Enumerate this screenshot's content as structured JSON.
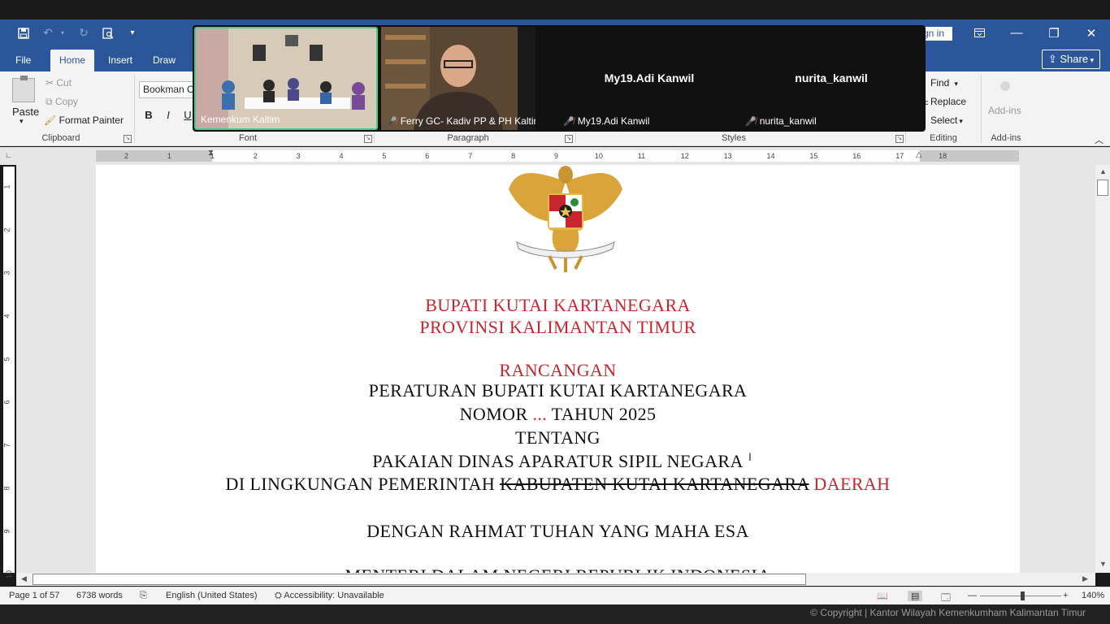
{
  "titlebar": {
    "sign_in": "gn in"
  },
  "tabs": [
    "File",
    "Home",
    "Insert",
    "Draw"
  ],
  "share_label": "Share",
  "ribbon": {
    "paste": "Paste",
    "cut": "Cut",
    "copy": "Copy",
    "format_painter": "Format Painter",
    "font_name": "Bookman O",
    "bold": "B",
    "italic": "I",
    "underline": "U",
    "find": "Find",
    "replace": "Replace",
    "select": "Select",
    "addins": "Add-ins",
    "groups": {
      "clipboard": "Clipboard",
      "font": "Font",
      "paragraph": "Paragraph",
      "styles": "Styles",
      "editing": "Editing",
      "addins": "Add-ins"
    }
  },
  "ruler_numbers": [
    "2",
    "1",
    "1",
    "2",
    "3",
    "4",
    "5",
    "6",
    "7",
    "8",
    "9",
    "10",
    "11",
    "12",
    "13",
    "14",
    "15",
    "16",
    "17",
    "18"
  ],
  "vruler_numbers": [
    "1",
    "2",
    "3",
    "4",
    "5",
    "6",
    "7",
    "8",
    "9",
    "10"
  ],
  "video": {
    "tiles": [
      {
        "name": "Kemenkum Kaltim"
      },
      {
        "name": "Ferry GC- Kadiv PP & PH Kaltim"
      },
      {
        "name": "My19.Adi Kanwil",
        "display": "My19.Adi Kanwil"
      },
      {
        "name": "nurita_kanwil",
        "display": "nurita_kanwil"
      }
    ]
  },
  "document": {
    "line1": "BUPATI KUTAI KARTANEGARA",
    "line2": "PROVINSI KALIMANTAN TIMUR",
    "line3": "RANCANGAN",
    "line4": "PERATURAN BUPATI KUTAI KARTANEGARA",
    "line5_a": "NOMOR ",
    "line5_b": "...",
    "line5_c": " TAHUN 2025",
    "line6": "TENTANG",
    "line7": "PAKAIAN DINAS APARATUR SIPIL NEGARA",
    "line8_a": "DI LINGKUNGAN PEMERINTAH ",
    "line8_b": "KABUPATEN KUTAI KARTANEGARA",
    "line8_c": " DAERAH",
    "line9": "DENGAN RAHMAT TUHAN YANG MAHA ESA",
    "line10": "MENTERI DALAM NEGERI REPUBLIK INDONESIA"
  },
  "status": {
    "page": "Page 1 of 57",
    "words": "6738 words",
    "language": "English (United States)",
    "accessibility": "Accessibility: Unavailable",
    "zoom": "140%"
  },
  "footer": "© Copyright | Kantor Wilayah Kemenkumham Kalimantan Timur"
}
